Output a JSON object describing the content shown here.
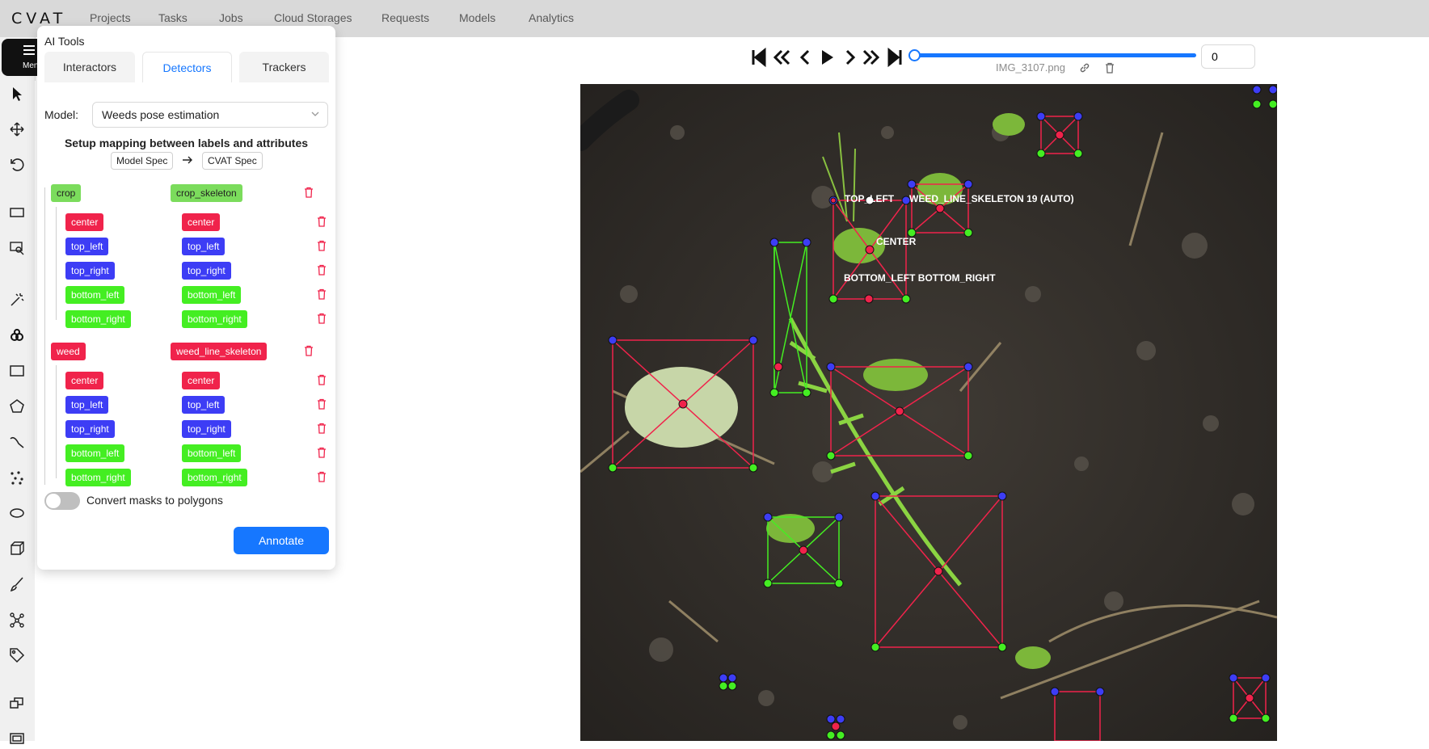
{
  "app": {
    "logo": "CVAT"
  },
  "nav": {
    "items": [
      "Projects",
      "Tasks",
      "Jobs",
      "Cloud Storages",
      "Requests",
      "Models",
      "Analytics"
    ]
  },
  "menu": {
    "label": "Menu"
  },
  "player": {
    "frame": "0",
    "filename": "IMG_3107.png",
    "progress": 0.0
  },
  "panel": {
    "title": "AI Tools",
    "tabs": [
      "Interactors",
      "Detectors",
      "Trackers"
    ],
    "active_tab": "Detectors",
    "model_label": "Model:",
    "model_value": "Weeds pose estimation",
    "mapping_title": "Setup mapping between labels and attributes",
    "model_spec": "Model Spec",
    "cvat_spec": "CVAT Spec",
    "groups": [
      {
        "label": "crop",
        "target": "crop_skeleton",
        "points": [
          "center",
          "top_left",
          "top_right",
          "bottom_left",
          "bottom_right"
        ]
      },
      {
        "label": "weed",
        "target": "weed_line_skeleton",
        "points": [
          "center",
          "top_left",
          "top_right",
          "bottom_left",
          "bottom_right"
        ]
      }
    ],
    "convert_label": "Convert masks to polygons",
    "annotate_label": "Annotate"
  },
  "canvas_labels": {
    "top_left": "TOP_LEFT",
    "skeleton": "WEED_LINE_SKELETON 19 (AUTO)",
    "center": "CENTER",
    "bottom": "BOTTOM_LEFT BOTTOM_RIGHT"
  },
  "colors": {
    "accent": "#1677ff",
    "red": "#f0234b",
    "blue": "#3d3df5",
    "green": "#44ee22",
    "crop_label": "#7bdc5c"
  }
}
